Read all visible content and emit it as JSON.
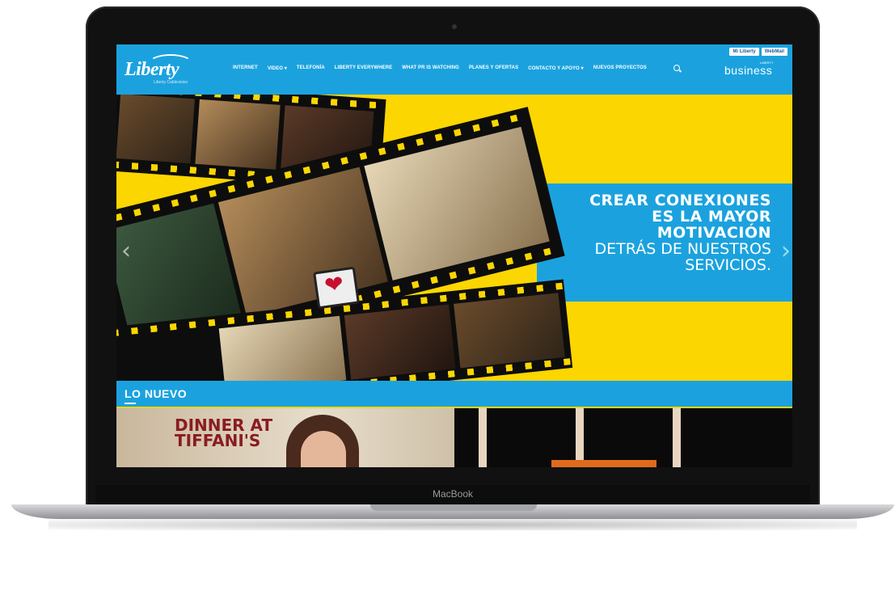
{
  "device": {
    "label": "MacBook"
  },
  "site": {
    "logo": "Liberty",
    "logo_sub": "Liberty Cablevision",
    "nav": [
      "INTERNET",
      "VIDEO ▾",
      "TELEFONÍA",
      "LIBERTY EVERYWHERE",
      "WHAT PR IS WATCHING",
      "PLANES Y OFERTAS",
      "CONTACTO Y APOYO ▾",
      "NUEVOS PROYECTOS"
    ],
    "top_buttons": [
      "Mi Liberty",
      "WebMail"
    ],
    "business": "business",
    "business_tag": "LIBERTY"
  },
  "hero": {
    "line1": "CREAR CONEXIONES",
    "line2": "ES LA MAYOR",
    "line3": "MOTIVACIÓN",
    "line4": "DETRÁS DE NUESTROS",
    "line5": "SERVICIOS."
  },
  "section": {
    "title": "LO NUEVO"
  },
  "thumbs": {
    "show1_line1": "DINNER AT",
    "show1_line2": "TIFFANI'S"
  },
  "colors": {
    "brand_blue": "#1ba2de",
    "hero_yellow": "#fcd600"
  }
}
